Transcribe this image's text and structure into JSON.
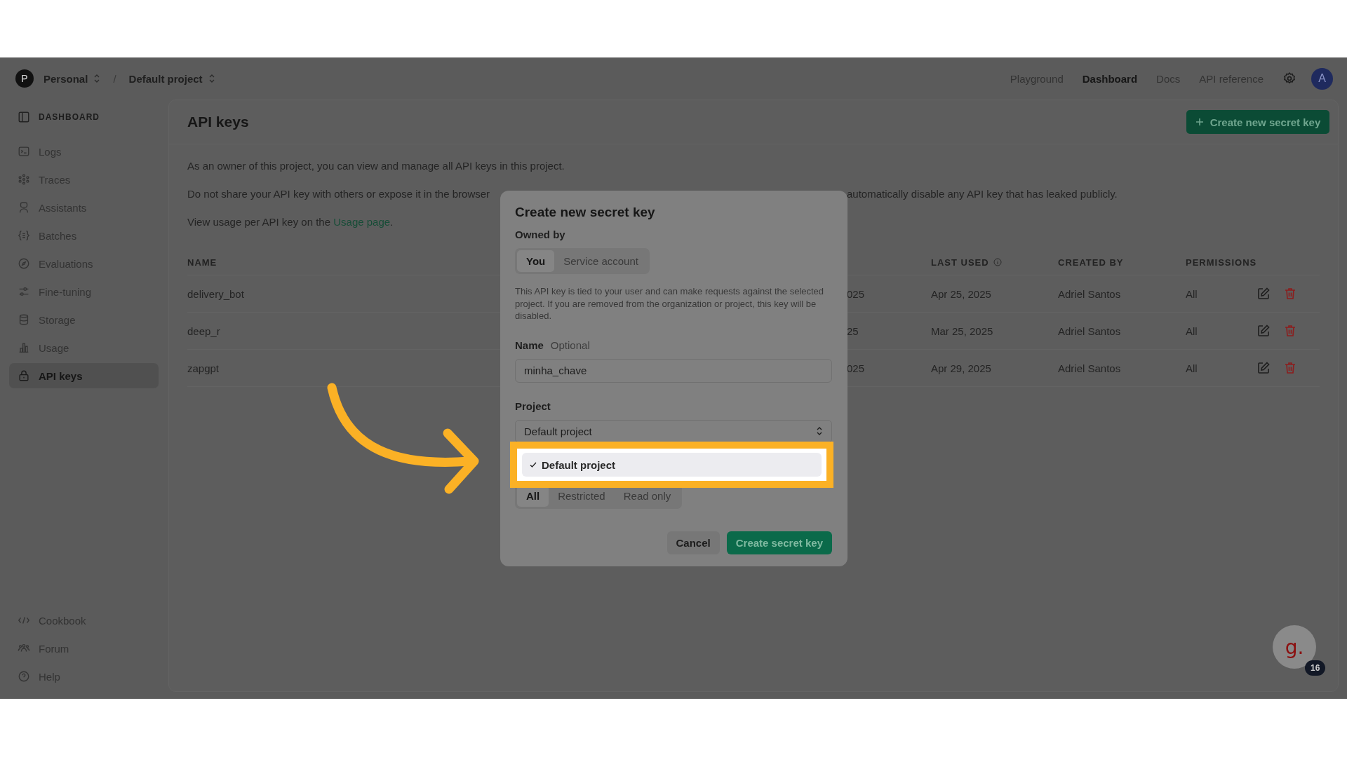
{
  "topbar": {
    "org": {
      "initial": "P",
      "label": "Personal"
    },
    "separator": "/",
    "project": "Default project",
    "nav": [
      {
        "label": "Playground",
        "selected": false
      },
      {
        "label": "Dashboard",
        "selected": true
      },
      {
        "label": "Docs",
        "selected": false
      },
      {
        "label": "API reference",
        "selected": false
      }
    ],
    "avatar": "A"
  },
  "sidebar": {
    "heading": "DASHBOARD",
    "items": [
      {
        "label": "Logs",
        "selected": false
      },
      {
        "label": "Traces",
        "selected": false
      },
      {
        "label": "Assistants",
        "selected": false
      },
      {
        "label": "Batches",
        "selected": false
      },
      {
        "label": "Evaluations",
        "selected": false
      },
      {
        "label": "Fine-tuning",
        "selected": false
      },
      {
        "label": "Storage",
        "selected": false
      },
      {
        "label": "Usage",
        "selected": false
      },
      {
        "label": "API keys",
        "selected": true
      }
    ],
    "footer_items": [
      {
        "label": "Cookbook"
      },
      {
        "label": "Forum"
      },
      {
        "label": "Help"
      }
    ]
  },
  "page": {
    "title": "API keys",
    "create_button": "Create new secret key",
    "intro": "As an owner of this project, you can view and manage all API keys in this project.",
    "warning_left": "Do not share your API key with others or expose it in the browser",
    "warning_right": "automatically disable any API key that has leaked publicly.",
    "usage_before": "View usage per API key on the ",
    "usage_link": "Usage page",
    "usage_after": ".",
    "table": {
      "columns": {
        "name": "NAME",
        "last_used": "LAST USED",
        "created_by": "CREATED BY",
        "permissions": "PERMISSIONS"
      },
      "rows": [
        {
          "name": "delivery_bot",
          "column_2": "025",
          "last_used": "Apr 25, 2025",
          "created_by": "Adriel Santos",
          "permissions": "All"
        },
        {
          "name": "deep_r",
          "column_2": "25",
          "last_used": "Mar 25, 2025",
          "created_by": "Adriel Santos",
          "permissions": "All"
        },
        {
          "name": "zapgpt",
          "column_2": "025",
          "last_used": "Apr 29, 2025",
          "created_by": "Adriel Santos",
          "permissions": "All"
        }
      ]
    }
  },
  "modal": {
    "title": "Create new secret key",
    "owned_by_label": "Owned by",
    "owner_options": [
      {
        "label": "You",
        "selected": true
      },
      {
        "label": "Service account",
        "selected": false
      }
    ],
    "description": "This API key is tied to your user and can make requests against the selected project. If you are removed from the organization or project, this key will be disabled.",
    "name_label": "Name",
    "name_hint": "Optional",
    "name_value": "minha_chave",
    "project_label": "Project",
    "project_value": "Default project",
    "project_options": [
      {
        "label": "Default project",
        "checked": true
      }
    ],
    "permission_options": [
      {
        "label": "All",
        "selected": true
      },
      {
        "label": "Restricted",
        "selected": false
      },
      {
        "label": "Read only",
        "selected": false
      }
    ],
    "cancel": "Cancel",
    "submit": "Create secret key"
  },
  "help_widget": {
    "logo": "g.",
    "badge": "16"
  }
}
